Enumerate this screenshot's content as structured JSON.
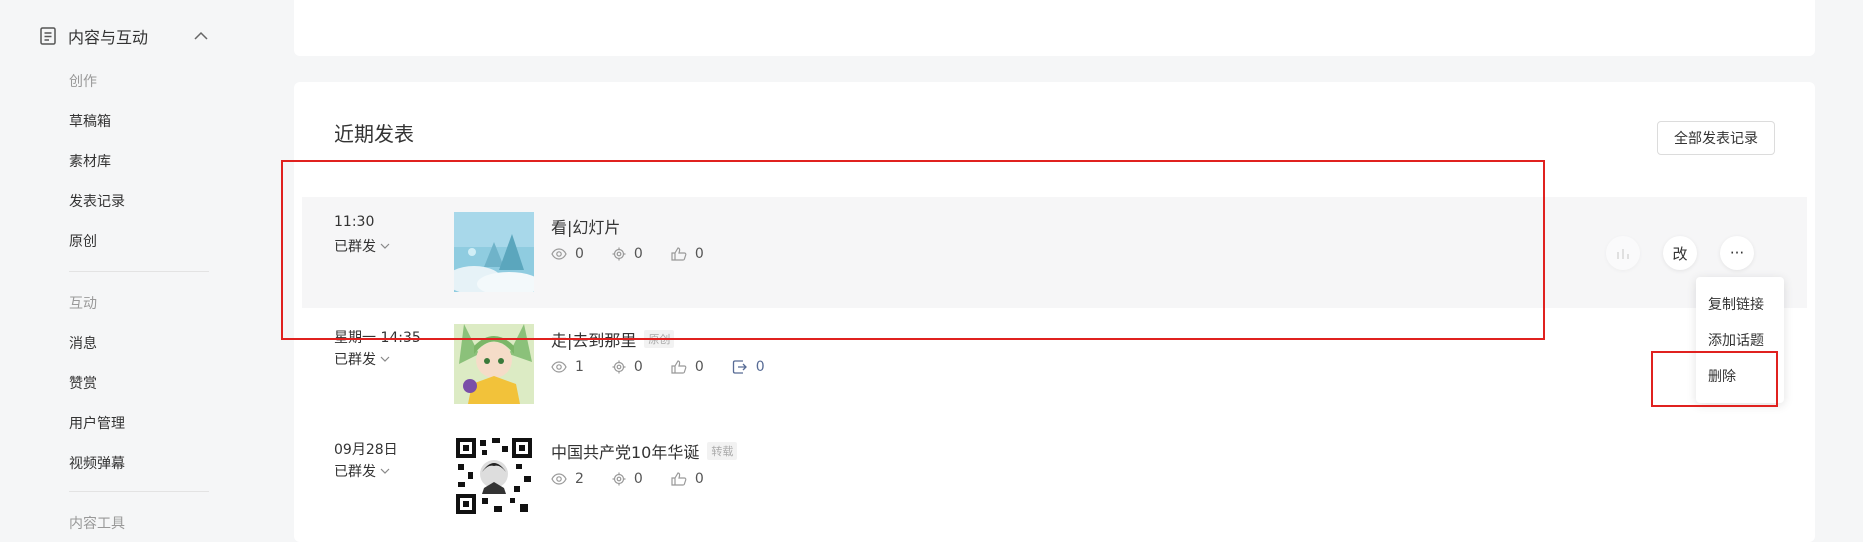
{
  "sidebar": {
    "section_title": "内容与互动",
    "groups": [
      {
        "title": "创作",
        "items": [
          "草稿箱",
          "素材库",
          "发表记录",
          "原创"
        ]
      },
      {
        "title": "互动",
        "items": [
          "消息",
          "赞赏",
          "用户管理",
          "视频弹幕"
        ]
      },
      {
        "title": "内容工具",
        "items": []
      }
    ]
  },
  "main": {
    "section_title": "近期发表",
    "all_records_button": "全部发表记录",
    "posts": [
      {
        "time": "11:30",
        "status": "已群发",
        "title": "看|幻灯片",
        "badge": "",
        "views": "0",
        "shares": "0",
        "likes": "0",
        "forwards": ""
      },
      {
        "time": "星期一 14:35",
        "status": "已群发",
        "title": "走|去到那里",
        "badge": "原创",
        "views": "1",
        "shares": "0",
        "likes": "0",
        "forwards": "0"
      },
      {
        "time": "09月28日",
        "status": "已群发",
        "title": "中国共产党10年华诞",
        "badge": "转载",
        "views": "2",
        "shares": "0",
        "likes": "0",
        "forwards": ""
      }
    ],
    "row_actions": {
      "edit_label": "改",
      "more_label": "···"
    },
    "dropdown": [
      "复制链接",
      "添加话题",
      "删除"
    ]
  },
  "colors": {
    "accent_blue": "#576b95",
    "highlight_red": "#e0211f"
  }
}
